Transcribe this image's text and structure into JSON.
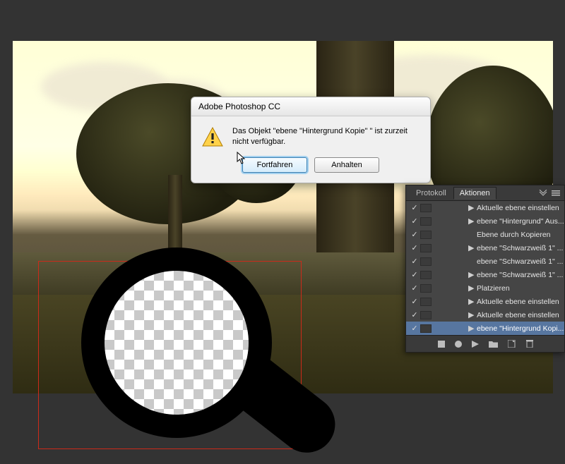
{
  "dialog": {
    "title": "Adobe Photoshop CC",
    "message": "Das Objekt \"ebene \"Hintergrund Kopie\" \" ist zurzeit nicht verfügbar.",
    "continue_label": "Fortfahren",
    "stop_label": "Anhalten"
  },
  "panel": {
    "tabs": {
      "protocol": "Protokoll",
      "actions": "Aktionen"
    },
    "rows": [
      {
        "tri": true,
        "label": "Aktuelle ebene einstellen",
        "sel": false
      },
      {
        "tri": true,
        "label": "ebene \"Hintergrund\" Aus...",
        "sel": false
      },
      {
        "tri": false,
        "label": "Ebene durch Kopieren",
        "sel": false
      },
      {
        "tri": true,
        "label": "ebene \"Schwarzweiß 1\" ...",
        "sel": false
      },
      {
        "tri": false,
        "label": "ebene \"Schwarzweiß 1\" ...",
        "sel": false
      },
      {
        "tri": true,
        "label": "ebene \"Schwarzweiß 1\" ...",
        "sel": false
      },
      {
        "tri": true,
        "label": "Platzieren",
        "sel": false
      },
      {
        "tri": true,
        "label": "Aktuelle ebene einstellen",
        "sel": false
      },
      {
        "tri": true,
        "label": "Aktuelle ebene einstellen",
        "sel": false
      },
      {
        "tri": true,
        "label": "ebene \"Hintergrund Kopi...",
        "sel": true
      }
    ],
    "footer_icons": {
      "stop": "stop-icon",
      "record": "record-icon",
      "play": "play-icon",
      "folder": "folder-icon",
      "new": "new-step-icon",
      "trash": "trash-icon"
    }
  }
}
